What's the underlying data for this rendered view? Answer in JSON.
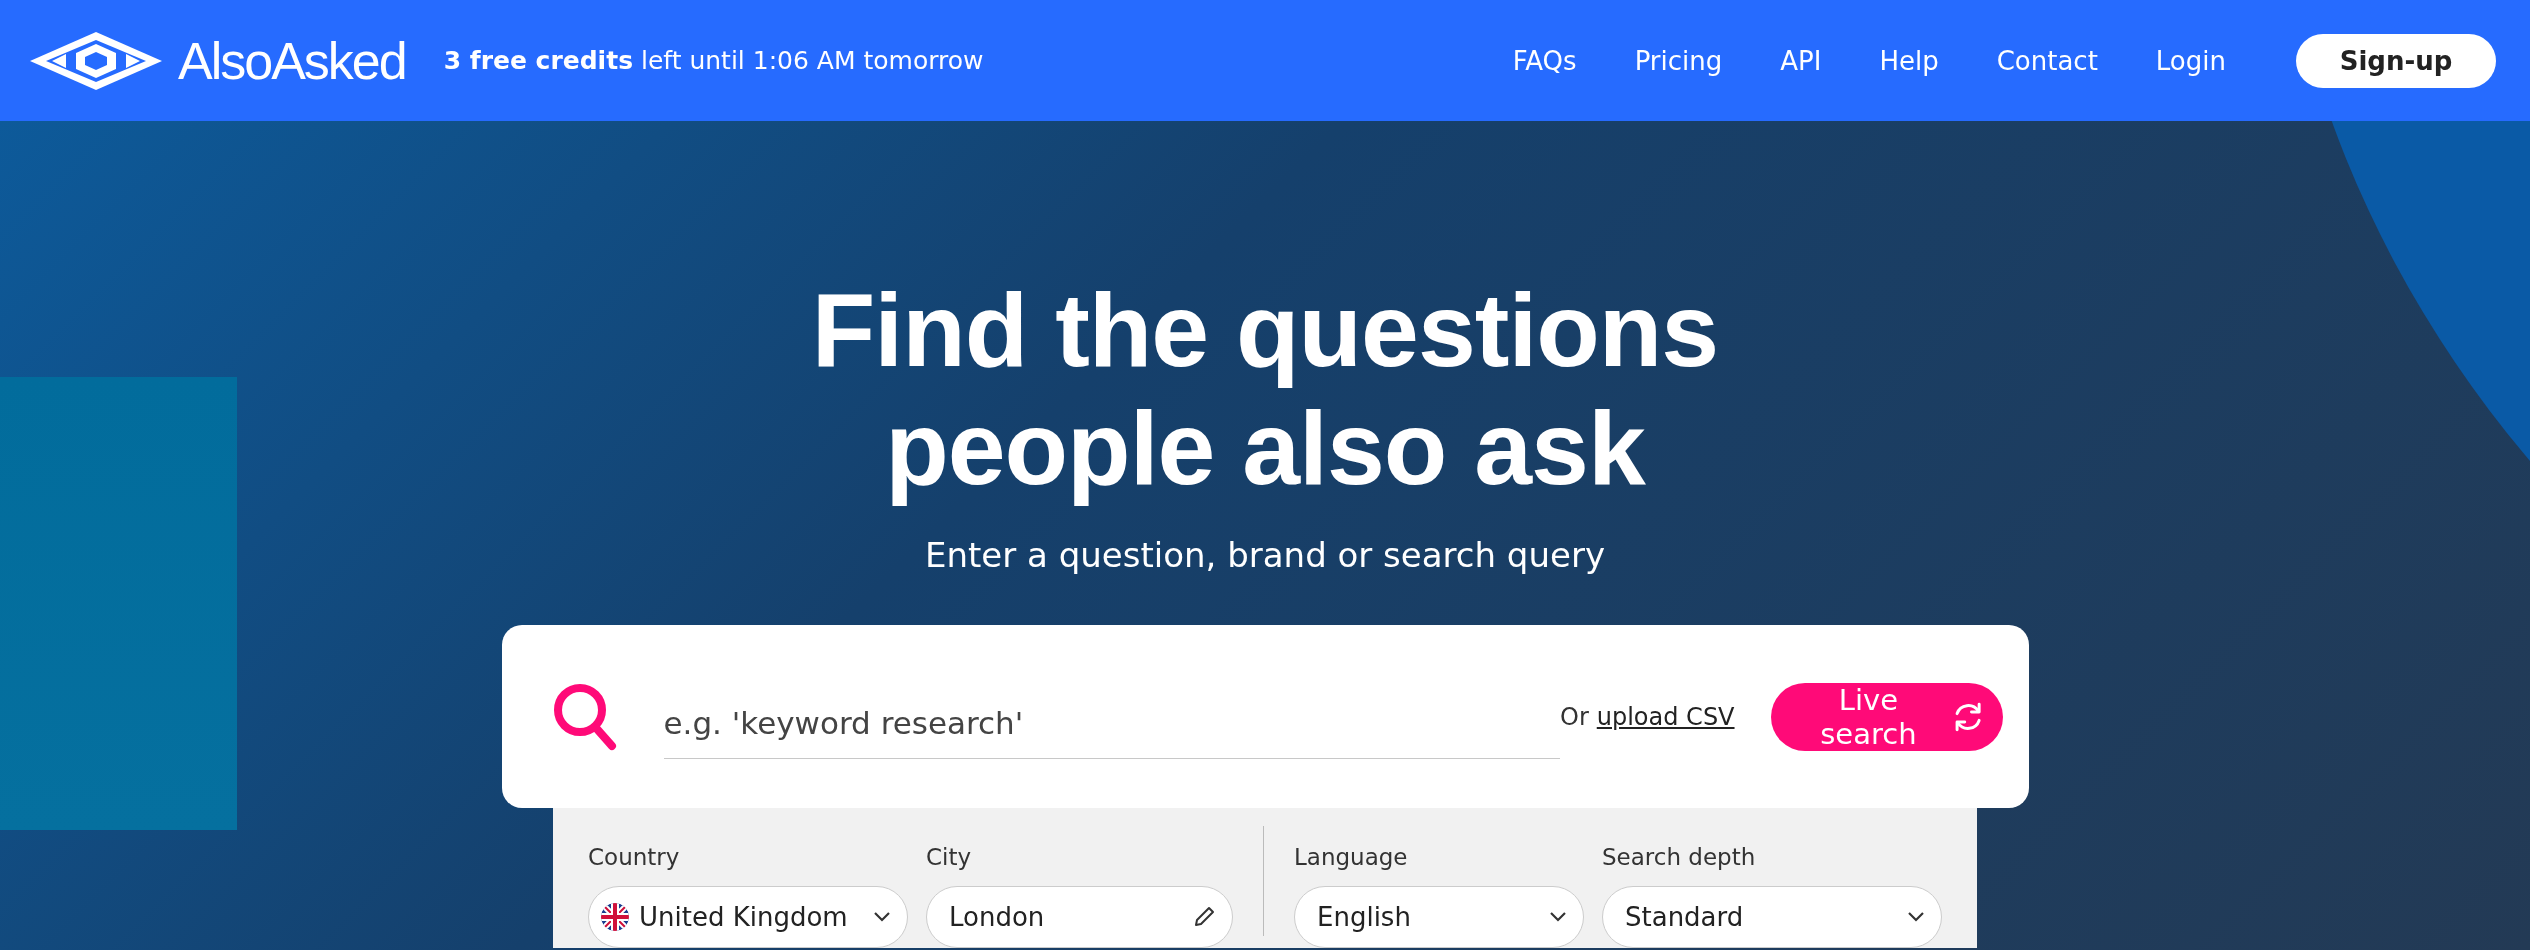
{
  "header": {
    "logo": "AlsoAsked",
    "credits": "**3 free credits** left until 1:06 AM tomorrow",
    "nav": [
      {
        "label": "FAQs"
      },
      {
        "label": "Pricing"
      },
      {
        "label": "API"
      },
      {
        "label": "Help"
      },
      {
        "label": "Contact"
      },
      {
        "label": "Login"
      }
    ],
    "signup": "Sign-up"
  },
  "hero": {
    "title_lines": [
      "Find the questions",
      "people also ask"
    ],
    "subtitle": "Enter a question, brand or search query"
  },
  "search": {
    "placeholder": "e.g. 'keyword research'",
    "upload_prefix": "Or",
    "upload_link": "upload CSV",
    "button": "Live search"
  },
  "filter_groups": [
    [
      {
        "label": "Country",
        "value": "United Kingdom",
        "kind": "select-flag"
      },
      {
        "label": "City",
        "value": "London",
        "kind": "text-edit"
      }
    ],
    [
      {
        "label": "Language",
        "value": "English",
        "kind": "select"
      },
      {
        "label": "Search depth",
        "value": "Standard",
        "kind": "select"
      }
    ]
  ]
}
